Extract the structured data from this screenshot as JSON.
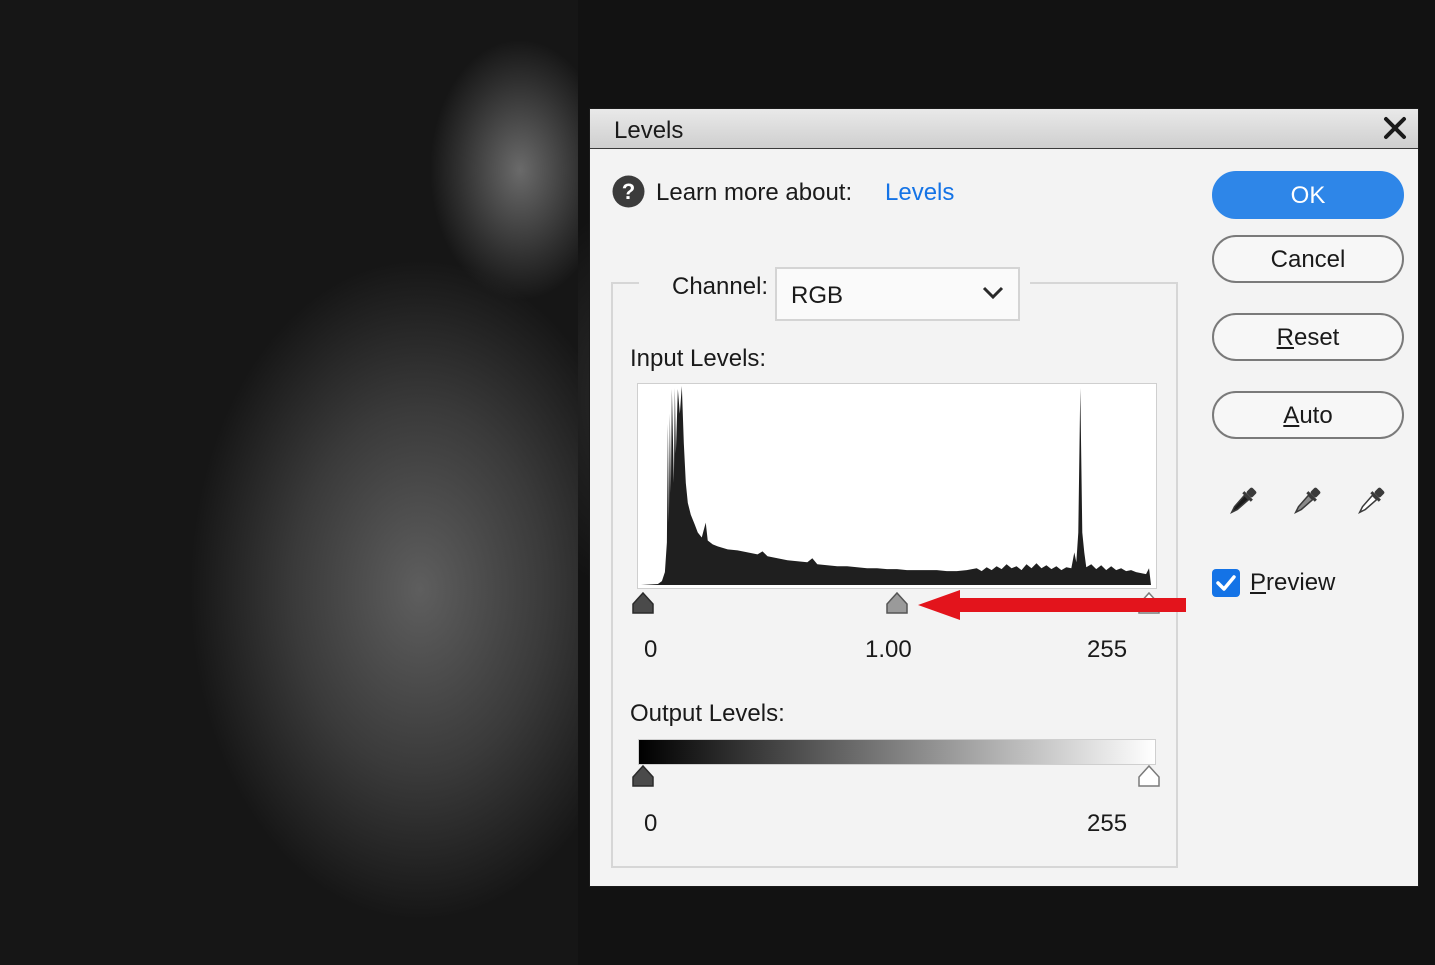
{
  "dialog": {
    "title": "Levels",
    "close_icon": "close-x-icon",
    "help": {
      "icon": "question-circle-icon",
      "label": "Learn more about:",
      "link": "Levels",
      "link_color": "#1473e6"
    },
    "channel": {
      "label": "Channel:",
      "value": "RGB"
    },
    "input_levels": {
      "label": "Input Levels:",
      "black": "0",
      "gamma": "1.00",
      "white": "255"
    },
    "output_levels": {
      "label": "Output Levels:",
      "black": "0",
      "white": "255"
    },
    "buttons": {
      "ok": "OK",
      "cancel": "Cancel",
      "reset_first": "R",
      "reset_rest": "eset",
      "auto_first": "A",
      "auto_rest": "uto"
    },
    "eyedroppers": [
      "eyedropper-black-icon",
      "eyedropper-gray-icon",
      "eyedropper-white-icon"
    ],
    "preview": {
      "first": "P",
      "rest": "review",
      "checked": true
    },
    "colors": {
      "ok_button": "#2e86e8",
      "checkbox": "#1473e6",
      "annotation_arrow": "#e3141c"
    }
  }
}
